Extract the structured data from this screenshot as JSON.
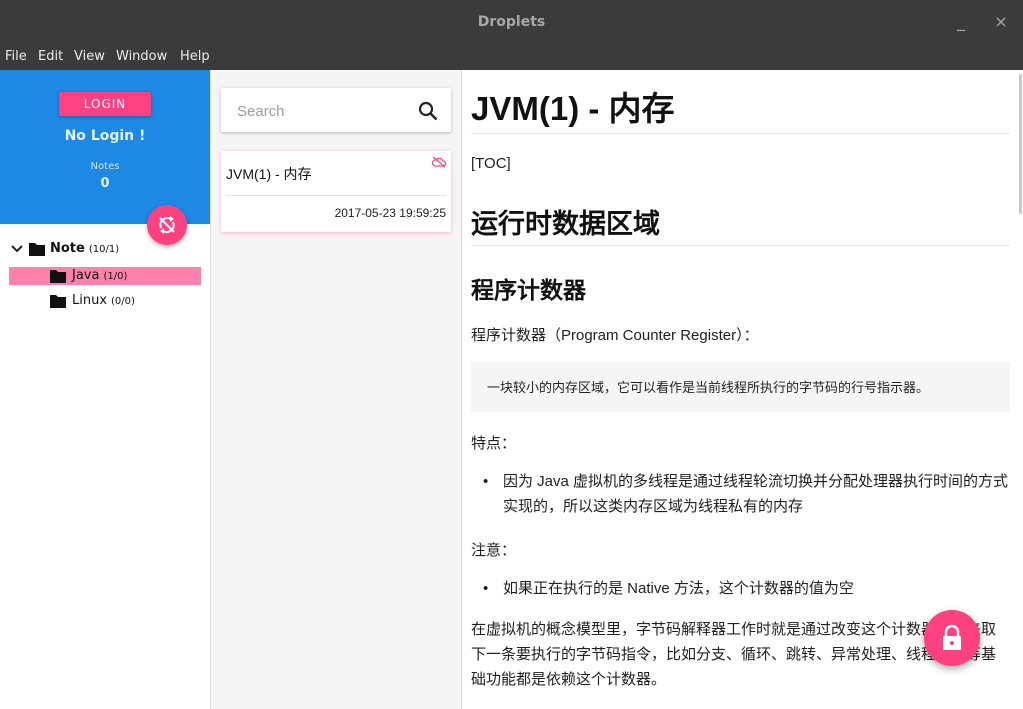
{
  "window": {
    "title": "Droplets",
    "minimize": "_",
    "close": "×"
  },
  "menu": [
    "File",
    "Edit",
    "View",
    "Window",
    "Help"
  ],
  "profile": {
    "login_label": "LOGIN",
    "status": "No Login !",
    "notes_label": "Notes",
    "notes_count": "0"
  },
  "tree": {
    "root": {
      "name": "Note",
      "count": "(10/1)"
    },
    "children": [
      {
        "name": "Java",
        "count": "(1/0)",
        "selected": true
      },
      {
        "name": "Linux",
        "count": "(0/0)",
        "selected": false
      }
    ]
  },
  "search": {
    "placeholder": "Search",
    "value": ""
  },
  "notes": [
    {
      "title": "JVM(1) - 内存",
      "date": "2017-05-23 19:59:25"
    }
  ],
  "doc": {
    "h1": "JVM(1) - 内存",
    "toc": "[TOC]",
    "h2": "运行时数据区域",
    "h3": "程序计数器",
    "p1": "程序计数器（Program Counter Register）：",
    "quote": "一块较小的内存区域，它可以看作是当前线程所执行的字节码的行号指示器。",
    "p2": "特点：",
    "li1": "因为 Java 虚拟机的多线程是通过线程轮流切换并分配处理器执行时间的方式实现的，所以这类内存区域为线程私有的内存",
    "p3": "注意：",
    "li2": "如果正在执行的是 Native 方法，这个计数器的值为空",
    "p4": "在虚拟机的概念模型里，字节码解释器工作时就是通过改变这个计数器的值来取下一条要执行的字节码指令，比如分支、循环、跳转、异常处理、线程恢复等基础功能都是依赖这个计数器。"
  },
  "colors": {
    "accent": "#ff4081",
    "primary": "#1e88e5",
    "titlebar": "#3b3b3b"
  }
}
